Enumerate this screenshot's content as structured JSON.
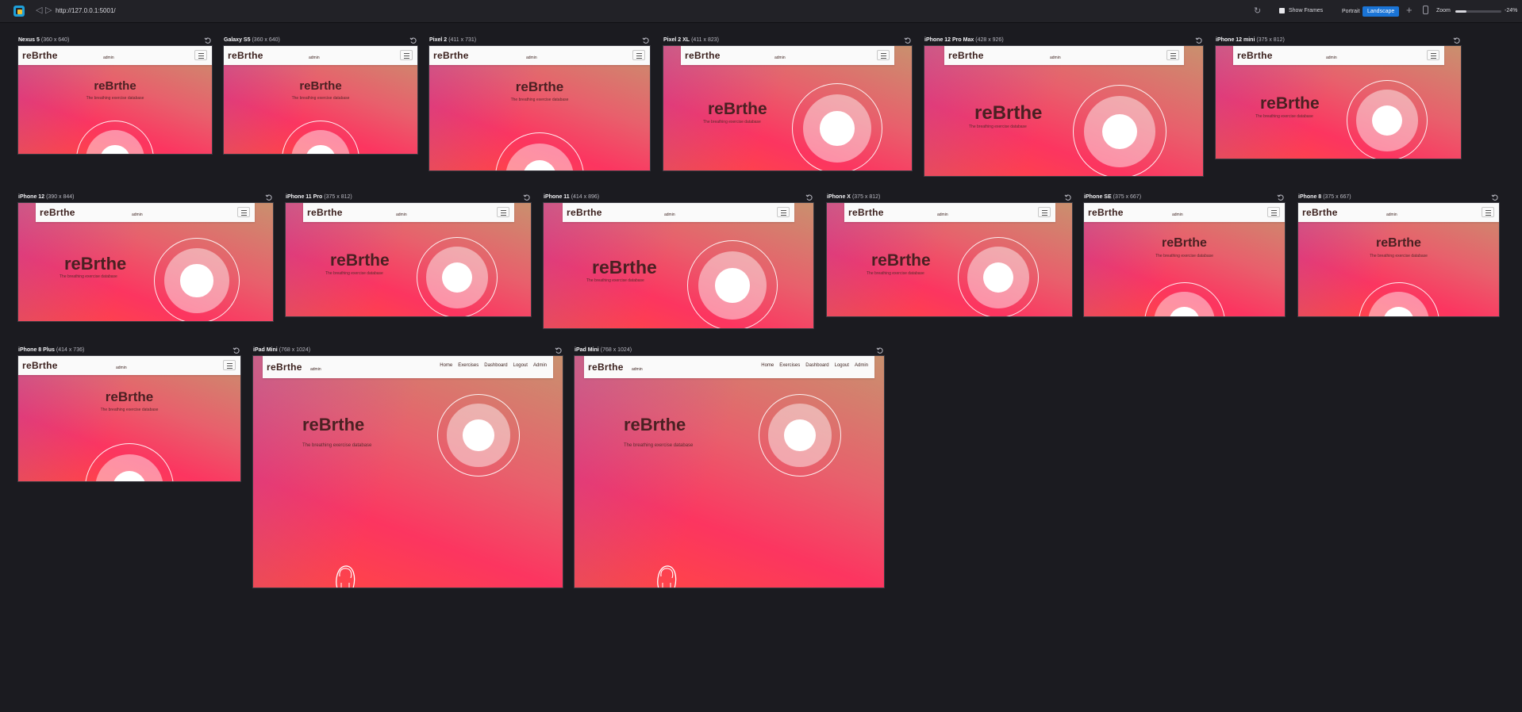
{
  "toolbar": {
    "back_icon": "back-arrow-icon",
    "forward_icon": "forward-arrow-icon",
    "url": "http://127.0.0.1:5001/",
    "reload_icon": "reload-icon",
    "show_frames_label": "Show Frames",
    "portrait_label": "Portrait",
    "landscape_label": "Landscape",
    "add_icon": "plus-icon",
    "device_icon": "device-icon",
    "zoom_label": "Zoom",
    "zoom_value": "-24%",
    "zoom_fraction": 0.24
  },
  "app": {
    "logo": "reBrthe",
    "title": "reBrthe",
    "subtitle": "The breathing exercise database",
    "user": "admin",
    "nav_links": [
      "Home",
      "Exercises",
      "Dashboard",
      "Logout",
      "Admin"
    ]
  },
  "devices": [
    {
      "name": "Nexus 5",
      "dims": "(360 x 640)"
    },
    {
      "name": "Galaxy S5",
      "dims": "(360 x 640)"
    },
    {
      "name": "Pixel 2",
      "dims": "(411 x 731)"
    },
    {
      "name": "Pixel 2 XL",
      "dims": "(411 x 823)"
    },
    {
      "name": "iPhone 12 Pro Max",
      "dims": "(428 x 926)"
    },
    {
      "name": "iPhone 12 mini",
      "dims": "(375 x 812)"
    },
    {
      "name": "iPhone 12",
      "dims": "(390 x 844)"
    },
    {
      "name": "iPhone 11 Pro",
      "dims": "(375 x 812)"
    },
    {
      "name": "iPhone 11",
      "dims": "(414 x 896)"
    },
    {
      "name": "iPhone X",
      "dims": "(375 x 812)"
    },
    {
      "name": "iPhone SE",
      "dims": "(375 x 667)"
    },
    {
      "name": "iPhone 8",
      "dims": "(375 x 667)"
    },
    {
      "name": "iPhone 8 Plus",
      "dims": "(414 x 736)"
    },
    {
      "name": "iPad Mini",
      "dims": "(768 x 1024)"
    },
    {
      "name": "iPad Mini",
      "dims": "(768 x 1024)"
    }
  ]
}
